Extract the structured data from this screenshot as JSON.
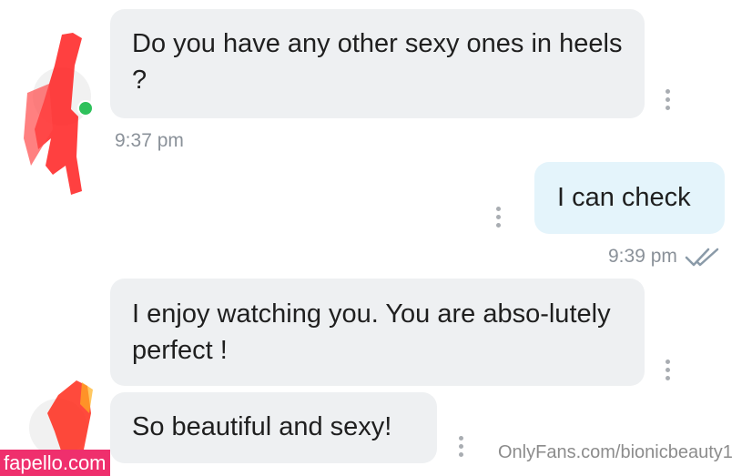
{
  "messages": [
    {
      "text": "Do you have any other sexy ones in heels ?",
      "time": "9:37 pm"
    },
    {
      "text": "I can check",
      "time": "9:39 pm"
    },
    {
      "text": "I enjoy watching you. You are abso-lutely perfect !"
    },
    {
      "text": "So beautiful and sexy!"
    }
  ],
  "watermarks": {
    "left": "fapello.com",
    "right": "OnlyFans.com/bionicbeauty1"
  },
  "colors": {
    "incoming_bubble": "#eef0f2",
    "outgoing_bubble": "#e4f4fb",
    "online_status": "#2ec15b",
    "read_ticks": "#8a9aa8",
    "watermark_bg": "#ef2f6d"
  },
  "icons": [
    "more-options-icon",
    "double-check-read-icon"
  ]
}
